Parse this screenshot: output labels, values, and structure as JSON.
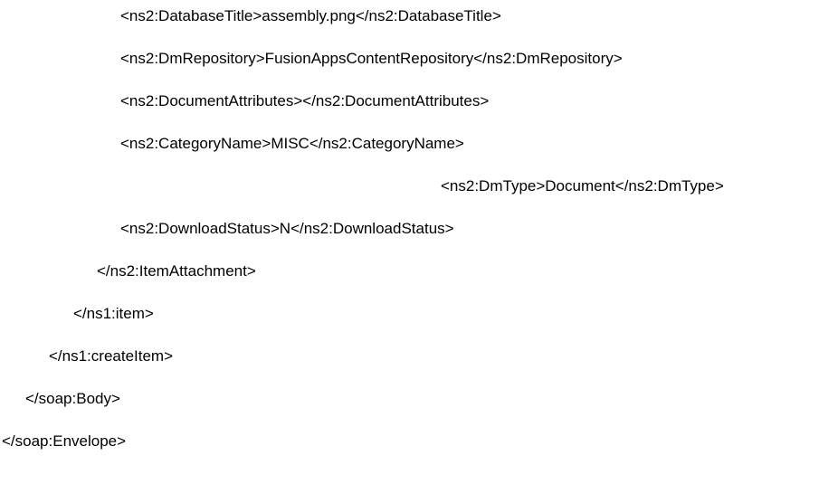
{
  "lines": [
    "<ns2:DatabaseTitle>assembly.png</ns2:DatabaseTitle>",
    "<ns2:DmRepository>FusionAppsContentRepository</ns2:DmRepository>",
    "<ns2:DocumentAttributes></ns2:DocumentAttributes>",
    "<ns2:CategoryName>MISC</ns2:CategoryName>",
    "<ns2:DmType>Document</ns2:DmType>",
    "<ns2:DownloadStatus>N</ns2:DownloadStatus>",
    "</ns2:ItemAttachment>",
    "</ns1:item>",
    "</ns1:createItem>",
    "</soap:Body>",
    "</soap:Envelope>"
  ]
}
